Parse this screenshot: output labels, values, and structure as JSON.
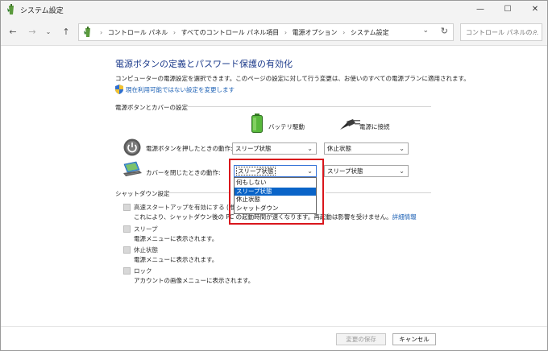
{
  "window": {
    "title": "システム設定",
    "controls": {
      "minimize": "—",
      "maximize": "☐",
      "close": "✕"
    }
  },
  "nav": {
    "back": "←",
    "forward": "→",
    "dropdown": "⌄",
    "up": "↑",
    "breadcrumb": [
      "コントロール パネル",
      "すべてのコントロール パネル項目",
      "電源オプション",
      "システム設定"
    ],
    "separator": "›",
    "address_dropdown": "⌄",
    "refresh": "↻",
    "search_placeholder": "コントロール パネルの...",
    "search_icon": "⌕"
  },
  "page": {
    "title": "電源ボタンの定義とパスワード保護の有効化",
    "description": "コンピューターの電源設定を選択できます。このページの設定に対して行う変更は、お使いのすべての電源プランに適用されます。",
    "change_link": "現在利用可能ではない設定を変更します"
  },
  "buttons_section": {
    "heading": "電源ボタンとカバーの設定",
    "battery_label": "バッテリ駆動",
    "plugged_label": "電源に接続",
    "rows": [
      {
        "label": "電源ボタンを押したときの動作:",
        "battery": "スリープ状態",
        "plugged": "休止状態"
      },
      {
        "label": "カバーを閉じたときの動作:",
        "battery": "スリープ状態",
        "plugged": "スリープ状態"
      }
    ],
    "select_chevron": "⌄",
    "dropdown_options": [
      {
        "label": "何もしない",
        "selected": false
      },
      {
        "label": "スリープ状態",
        "selected": true
      },
      {
        "label": "休止状態",
        "selected": false
      },
      {
        "label": "シャットダウン",
        "selected": false
      }
    ]
  },
  "shutdown_section": {
    "heading": "シャットダウン設定",
    "items": [
      {
        "label": "高速スタートアップを有効にする (推奨)",
        "sub": "これにより、シャットダウン後の PC の起動時間が速くなります。再起動は影響を受けません。",
        "more": "詳細情報"
      },
      {
        "label": "スリープ",
        "sub": "電源メニューに表示されます。"
      },
      {
        "label": "休止状態",
        "sub": "電源メニューに表示されます。"
      },
      {
        "label": "ロック",
        "sub": "アカウントの画像メニューに表示されます。"
      }
    ]
  },
  "footer": {
    "save": "変更の保存",
    "cancel": "キャンセル"
  },
  "colors": {
    "title_blue": "#1e3c8c",
    "link_blue": "#1a5fb4",
    "selection_blue": "#0a64c8",
    "highlight_red": "#d9161c"
  }
}
